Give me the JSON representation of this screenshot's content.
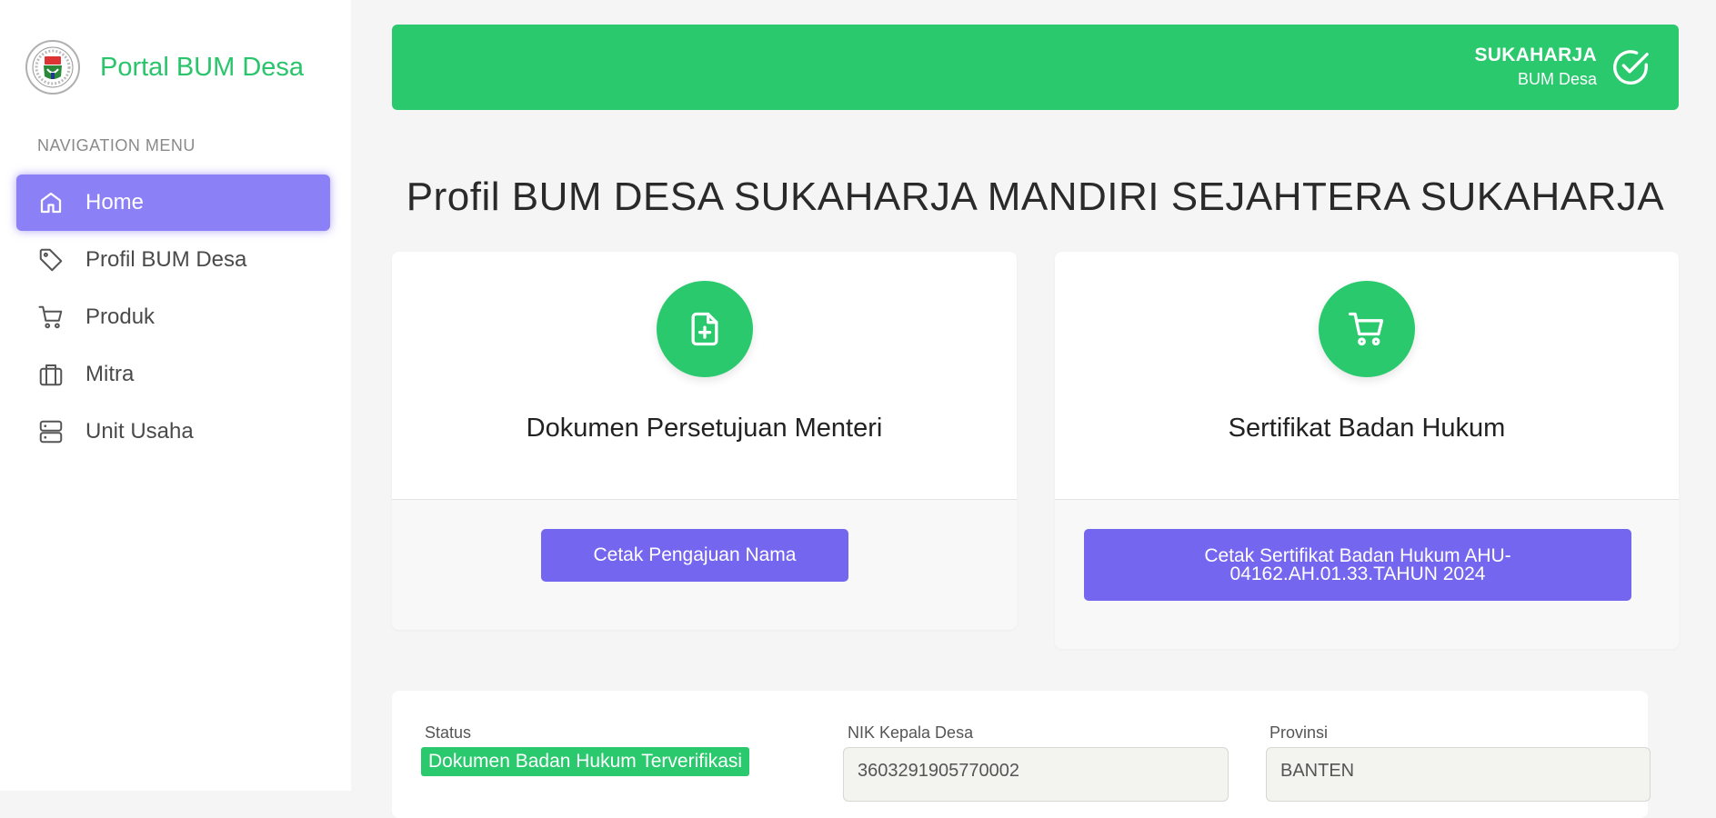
{
  "sidebar": {
    "brand": "Portal BUM Desa",
    "nav_heading": "NAVIGATION MENU",
    "items": [
      {
        "label": "Home",
        "icon": "home-icon",
        "active": true
      },
      {
        "label": "Profil BUM Desa",
        "icon": "tag-icon",
        "active": false
      },
      {
        "label": "Produk",
        "icon": "cart-icon",
        "active": false
      },
      {
        "label": "Mitra",
        "icon": "briefcase-icon",
        "active": false
      },
      {
        "label": "Unit Usaha",
        "icon": "server-icon",
        "active": false
      }
    ]
  },
  "header": {
    "user_name": "SUKAHARJA",
    "user_role": "BUM Desa",
    "icon": "check-circle-icon"
  },
  "page_title": "Profil BUM DESA SUKAHARJA MANDIRI SEJAHTERA SUKAHARJA",
  "cards": [
    {
      "title": "Dokumen Persetujuan Menteri",
      "icon": "file-plus-icon",
      "button": "Cetak Pengajuan Nama"
    },
    {
      "title": "Sertifikat Badan Hukum",
      "icon": "cart-icon",
      "button": "Cetak Sertifikat Badan Hukum AHU-04162.AH.01.33.TAHUN 2024"
    }
  ],
  "info": {
    "status_label": "Status",
    "status_value": "Dokumen Badan Hukum Terverifikasi",
    "nik_label": "NIK Kepala Desa",
    "nik_value": "3603291905770002",
    "provinsi_label": "Provinsi",
    "provinsi_value": "BANTEN"
  },
  "colors": {
    "accent_green": "#2ac96e",
    "accent_purple": "#7566ef",
    "nav_active": "#8b80f5"
  }
}
